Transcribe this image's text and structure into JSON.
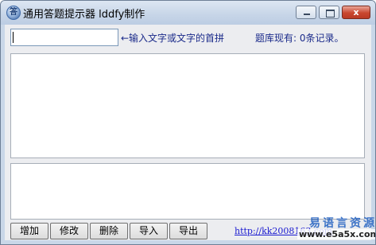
{
  "window": {
    "title": "通用答题提示器  lddfy制作",
    "close_symbol": "x"
  },
  "search": {
    "value": ""
  },
  "hint_text": "←输入文字或文字的首拼",
  "record_count_text": "题库现有: 0条记录。",
  "buttons": [
    "增加",
    "修改",
    "删除",
    "导入",
    "导出"
  ],
  "link_text": "http://kk2008163.com",
  "watermark": {
    "line1": "易语言资源网",
    "line2": "www.e5a5x.com"
  },
  "icons": {
    "app": "app-icon"
  }
}
